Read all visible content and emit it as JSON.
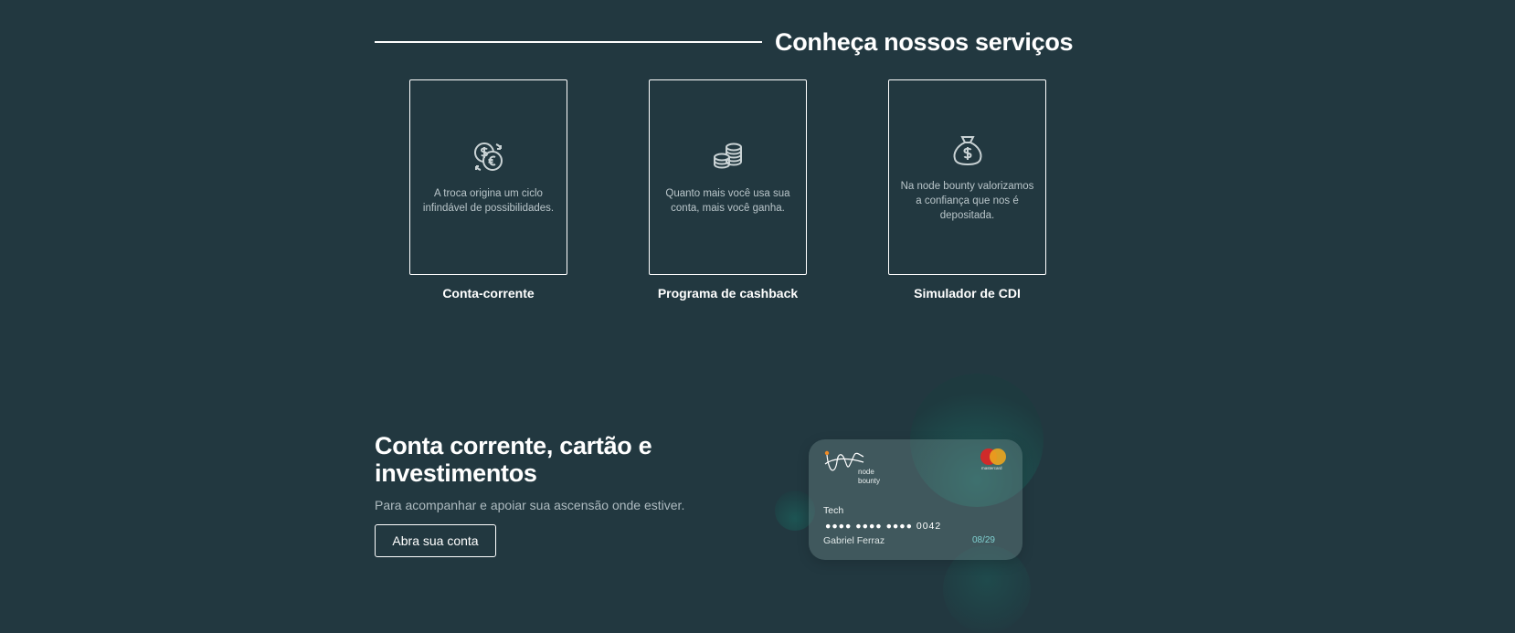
{
  "services": {
    "title": "Conheça nossos serviços",
    "cards": [
      {
        "icon": "currency-exchange-icon",
        "description": "A troca origina um ciclo infindável de possibilidades.",
        "label": "Conta-corrente"
      },
      {
        "icon": "coins-stack-icon",
        "description": "Quanto mais você usa sua conta, mais você ganha.",
        "label": "Programa de cashback"
      },
      {
        "icon": "money-bag-icon",
        "description": "Na node bounty valorizamos a confiança que nos é depositada.",
        "label": "Simulador de CDI"
      }
    ]
  },
  "promo": {
    "title_line1": "Conta corrente, cartão e",
    "title_line2": "investimentos",
    "subtitle": "Para acompanhar e apoiar sua ascensão onde estiver.",
    "button_label": "Abra sua conta"
  },
  "credit_card": {
    "brand_line1": "node",
    "brand_line2": "bounty",
    "network": "mastercard",
    "type": "Tech",
    "number": "●●●● ●●●● ●●●● 0042",
    "holder": "Gabriel Ferraz",
    "expiry": "08/29"
  },
  "colors": {
    "background": "#223840",
    "text": "#ffffff",
    "muted_text": "#b9c5c9",
    "accent_teal": "#1f5d5a"
  }
}
